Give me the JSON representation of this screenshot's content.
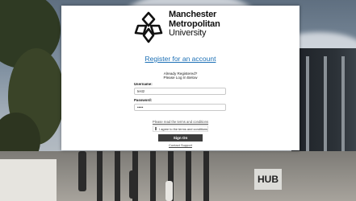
{
  "logo": {
    "line1": "Manchester",
    "line2": "Metropolitan",
    "line3": "University"
  },
  "register_link": "Register for an account",
  "login": {
    "heading": "Already Registered?",
    "subheading": "Please Log In Below",
    "username_label": "Username:",
    "username_value": "test2",
    "password_label": "Password:",
    "password_value": "•••••",
    "terms_link": "Please read the terms and conditions",
    "agree_label": "I agree to the terms and conditions",
    "sign_on_label": "Sign On",
    "contact_link": "Contact Support"
  },
  "background": {
    "building_sign": "HUB"
  }
}
